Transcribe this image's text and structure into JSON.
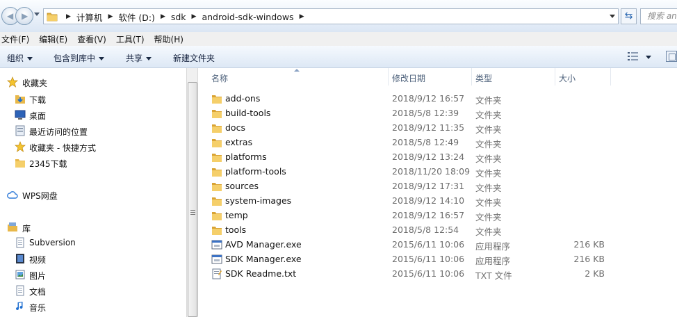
{
  "address_bar": {
    "crumbs": [
      "计算机",
      "软件 (D:)",
      "sdk",
      "android-sdk-windows"
    ],
    "search_placeholder": "搜索 and"
  },
  "menu": [
    "文件(F)",
    "编辑(E)",
    "查看(V)",
    "工具(T)",
    "帮助(H)"
  ],
  "toolbar": {
    "organize": "组织",
    "include_in_library": "包含到库中",
    "share": "共享",
    "new_folder": "新建文件夹"
  },
  "nav_pane": {
    "favorites": {
      "title": "收藏夹",
      "items": [
        "下载",
        "桌面",
        "最近访问的位置",
        "收藏夹 - 快捷方式",
        "2345下载"
      ]
    },
    "wps": "WPS网盘",
    "library": {
      "title": "库",
      "items": [
        "Subversion",
        "视频",
        "图片",
        "文档",
        "音乐"
      ]
    }
  },
  "columns": {
    "name": "名称",
    "date": "修改日期",
    "type": "类型",
    "size": "大小"
  },
  "files": [
    {
      "name": "add-ons",
      "date": "2018/9/12 16:57",
      "type": "文件夹",
      "size": "",
      "icon": "folder-icon"
    },
    {
      "name": "build-tools",
      "date": "2018/5/8 12:39",
      "type": "文件夹",
      "size": "",
      "icon": "folder-icon"
    },
    {
      "name": "docs",
      "date": "2018/9/12 11:35",
      "type": "文件夹",
      "size": "",
      "icon": "folder-icon"
    },
    {
      "name": "extras",
      "date": "2018/5/8 12:49",
      "type": "文件夹",
      "size": "",
      "icon": "folder-icon"
    },
    {
      "name": "platforms",
      "date": "2018/9/12 13:24",
      "type": "文件夹",
      "size": "",
      "icon": "folder-icon"
    },
    {
      "name": "platform-tools",
      "date": "2018/11/20 18:09",
      "type": "文件夹",
      "size": "",
      "icon": "folder-icon"
    },
    {
      "name": "sources",
      "date": "2018/9/12 17:31",
      "type": "文件夹",
      "size": "",
      "icon": "folder-icon"
    },
    {
      "name": "system-images",
      "date": "2018/9/12 14:10",
      "type": "文件夹",
      "size": "",
      "icon": "folder-icon"
    },
    {
      "name": "temp",
      "date": "2018/9/12 16:57",
      "type": "文件夹",
      "size": "",
      "icon": "folder-icon"
    },
    {
      "name": "tools",
      "date": "2018/5/8 12:54",
      "type": "文件夹",
      "size": "",
      "icon": "folder-icon"
    },
    {
      "name": "AVD Manager.exe",
      "date": "2015/6/11 10:06",
      "type": "应用程序",
      "size": "216 KB",
      "icon": "exe-icon"
    },
    {
      "name": "SDK Manager.exe",
      "date": "2015/6/11 10:06",
      "type": "应用程序",
      "size": "216 KB",
      "icon": "exe-icon"
    },
    {
      "name": "SDK Readme.txt",
      "date": "2015/6/11 10:06",
      "type": "TXT 文件",
      "size": "2 KB",
      "icon": "txt-icon"
    }
  ]
}
